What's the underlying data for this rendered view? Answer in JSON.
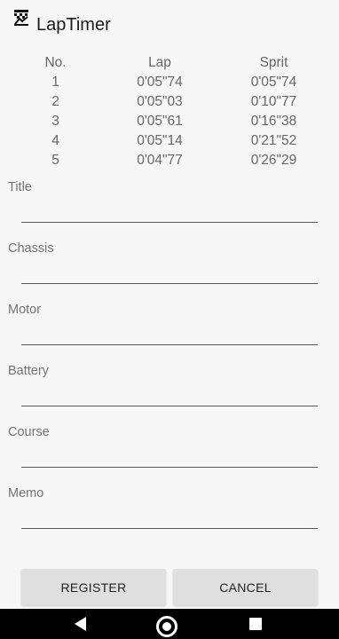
{
  "app": {
    "title": "LapTimer",
    "icon": "stopwatch-flag-icon"
  },
  "laps": {
    "headers": [
      "No.",
      "Lap",
      "Sprit"
    ],
    "rows": [
      [
        "1",
        "0'05\"74",
        "0'05\"74"
      ],
      [
        "2",
        "0'05\"03",
        "0'10\"77"
      ],
      [
        "3",
        "0'05\"61",
        "0'16\"38"
      ],
      [
        "4",
        "0'05\"14",
        "0'21\"52"
      ],
      [
        "5",
        "0'04\"77",
        "0'26\"29"
      ]
    ]
  },
  "form": {
    "title": {
      "label": "Title",
      "value": ""
    },
    "chassis": {
      "label": "Chassis",
      "value": ""
    },
    "motor": {
      "label": "Motor",
      "value": ""
    },
    "battery": {
      "label": "Battery",
      "value": ""
    },
    "course": {
      "label": "Course",
      "value": ""
    },
    "memo": {
      "label": "Memo",
      "value": ""
    }
  },
  "actions": {
    "register_label": "REGISTER",
    "cancel_label": "CANCEL"
  },
  "navbar": {
    "back_icon": "back-triangle-icon",
    "home_icon": "home-circle-icon",
    "recents_icon": "recents-square-icon"
  },
  "colors": {
    "background": "#f7f7f7",
    "button": "#dfdfdf",
    "navbar": "#000000"
  }
}
